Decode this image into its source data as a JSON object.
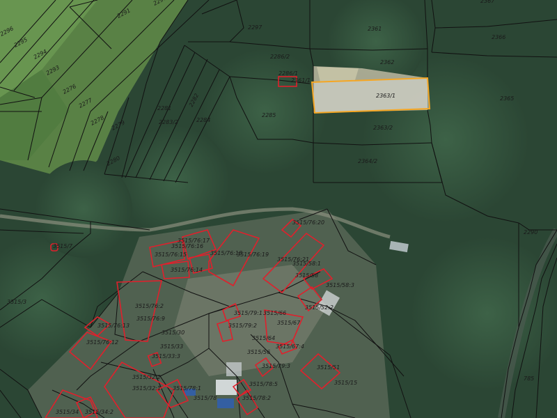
{
  "map": {
    "selected_parcel": "2363/1",
    "colors": {
      "parcel_line": "#111111",
      "building_outline": "#e0202c",
      "selected_outline": "#f5a623",
      "selected_fill": "#dfe2e0",
      "forest": "#2b4634",
      "meadow": "#5f8a47",
      "clearing": "#b4b39a"
    },
    "parcel_labels": [
      "2290",
      "2291",
      "2296",
      "2295",
      "2294",
      "2293",
      "2276",
      "2277",
      "2278",
      "2279",
      "2280",
      "2297",
      "2286/2",
      "2286/1",
      "2361/1",
      "2285",
      "2282",
      "2281",
      "2283/2",
      "2284",
      "2361",
      "2362",
      "2363/1",
      "2363/2",
      "2364/2",
      "2366",
      "2365",
      "2367",
      "2290",
      "3515/76:20",
      "3515/76:17",
      "3515/76:16",
      "3515/76:15",
      "3515/76:14",
      "3515/76:18",
      "3515/76:19",
      "3515/76:21",
      "3515/58:1",
      "3515/58",
      "3515/58:3",
      "3515/7",
      "3515/3",
      "3515/76:2",
      "3515/76:9",
      "3515/76:13",
      "3515/76:12",
      "3515/30",
      "3515/33",
      "3515/33:3",
      "3515/79:1",
      "3515/79:2",
      "3515/66",
      "3515/67",
      "3515/67:4",
      "3515/64",
      "3515/79:3",
      "3515/52:2",
      "3515/56",
      "3515/51",
      "3515/15",
      "3515/32:2",
      "3515/32:1",
      "3515/78:1",
      "3515/78",
      "3515/78:5",
      "3515/78:2",
      "3515/34",
      "3515/34:2",
      "785"
    ]
  }
}
